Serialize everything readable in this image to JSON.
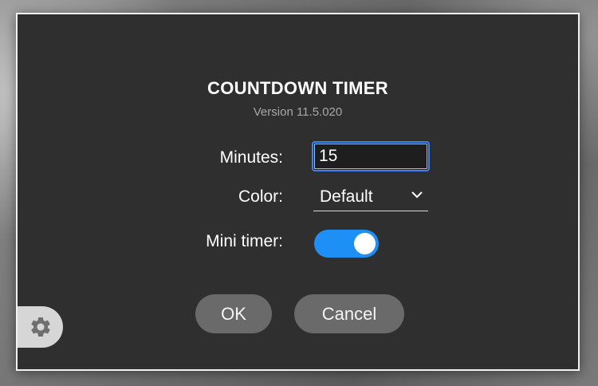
{
  "dialog": {
    "title": "COUNTDOWN TIMER",
    "version": "Version 11.5.020"
  },
  "form": {
    "minutes_label": "Minutes:",
    "minutes_value": "15",
    "color_label": "Color:",
    "color_value": "Default",
    "mini_timer_label": "Mini timer:",
    "mini_timer_on": true
  },
  "buttons": {
    "ok_label": "OK",
    "cancel_label": "Cancel"
  },
  "icons": {
    "settings": "gear-icon",
    "dropdown": "chevron-down-icon"
  },
  "colors": {
    "accent": "#1e90f5",
    "dialog_bg": "#2f2f2f",
    "button_bg": "#6a6a6a"
  }
}
